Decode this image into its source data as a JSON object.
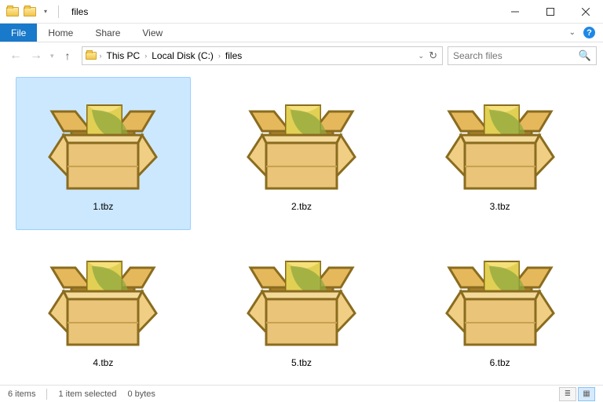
{
  "window": {
    "title": "files"
  },
  "ribbon": {
    "file": "File",
    "tabs": [
      "Home",
      "Share",
      "View"
    ]
  },
  "breadcrumb": {
    "parts": [
      "This PC",
      "Local Disk (C:)",
      "files"
    ]
  },
  "search": {
    "placeholder": "Search files"
  },
  "files": [
    {
      "name": "1.tbz",
      "selected": true
    },
    {
      "name": "2.tbz",
      "selected": false
    },
    {
      "name": "3.tbz",
      "selected": false
    },
    {
      "name": "4.tbz",
      "selected": false
    },
    {
      "name": "5.tbz",
      "selected": false
    },
    {
      "name": "6.tbz",
      "selected": false
    }
  ],
  "status": {
    "count": "6 items",
    "selection": "1 item selected",
    "size": "0 bytes"
  }
}
